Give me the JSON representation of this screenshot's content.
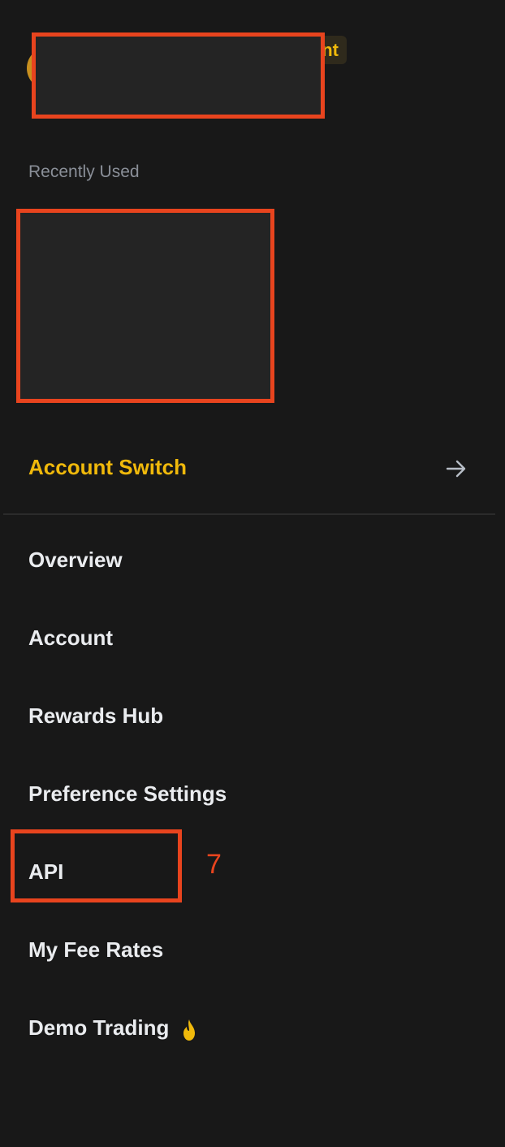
{
  "header": {
    "badge_text": "nt"
  },
  "recently_used": {
    "label": "Recently Used"
  },
  "account_switch": {
    "label": "Account Switch",
    "icon": "arrow-right-icon"
  },
  "menu": {
    "items": [
      {
        "label": "Overview"
      },
      {
        "label": "Account"
      },
      {
        "label": "Rewards Hub"
      },
      {
        "label": "Preference Settings"
      },
      {
        "label": "API"
      },
      {
        "label": "My Fee Rates"
      },
      {
        "label": "Demo Trading",
        "icon": "flame-icon"
      }
    ]
  },
  "annotation": {
    "step_number": "7"
  },
  "colors": {
    "background": "#181818",
    "accent": "#f0b90b",
    "text": "#eaecef",
    "muted": "#8a8f98",
    "annotation": "#e8441e"
  }
}
